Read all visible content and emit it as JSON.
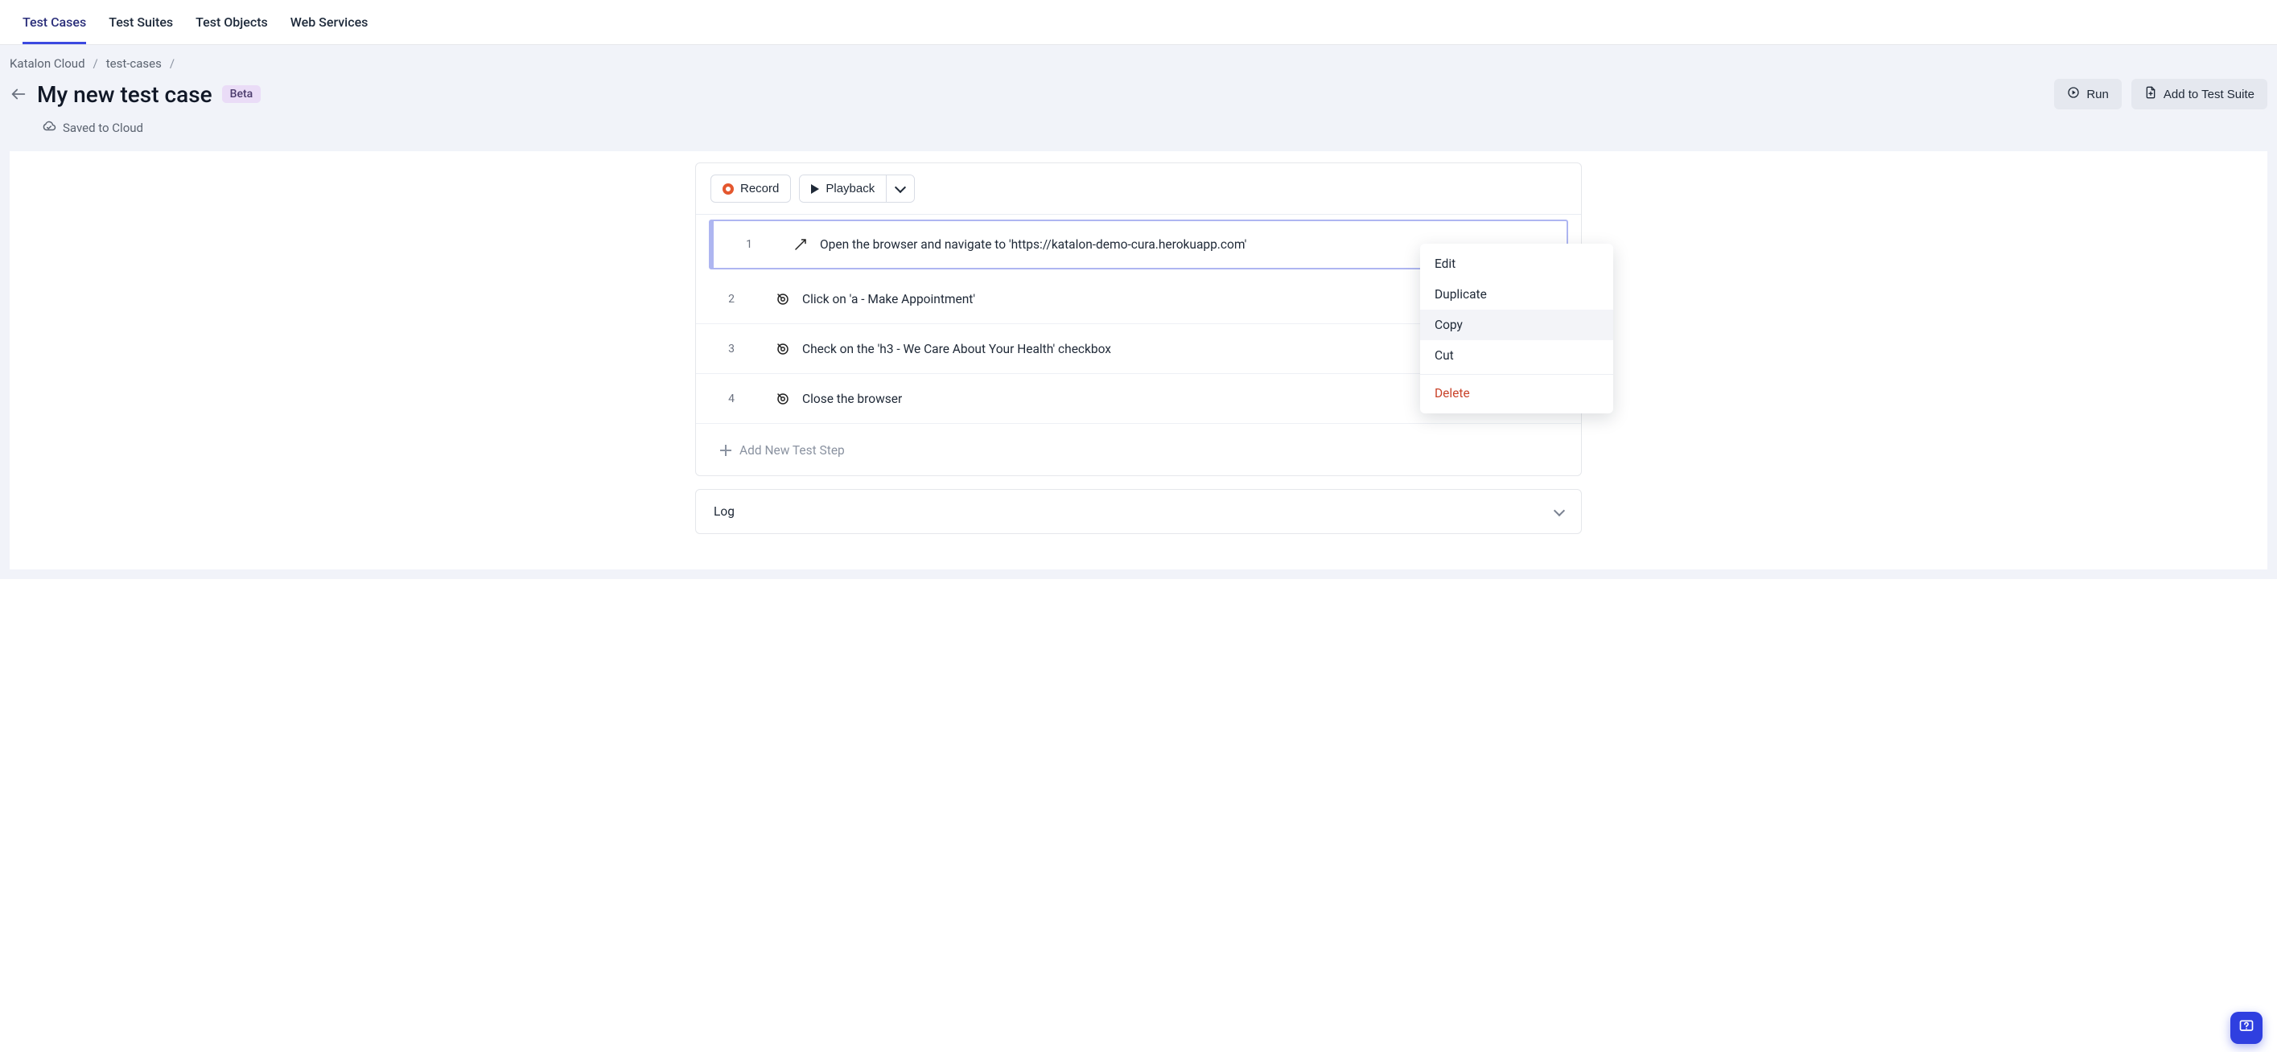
{
  "tabs": {
    "items": [
      {
        "label": "Test Cases",
        "active": true
      },
      {
        "label": "Test Suites",
        "active": false
      },
      {
        "label": "Test Objects",
        "active": false
      },
      {
        "label": "Web Services",
        "active": false
      }
    ]
  },
  "breadcrumbs": {
    "root": "Katalon Cloud",
    "second": "test-cases"
  },
  "header": {
    "title": "My new test case",
    "badge": "Beta",
    "saved_status": "Saved to Cloud",
    "run_label": "Run",
    "add_to_suite_label": "Add to Test Suite"
  },
  "toolbar": {
    "record_label": "Record",
    "playback_label": "Playback"
  },
  "steps": [
    {
      "num": "1",
      "icon": "navigate",
      "text": "Open the browser and navigate to 'https://katalon-demo-cura.herokuapp.com'",
      "selected": true
    },
    {
      "num": "2",
      "icon": "target",
      "text": "Click on 'a - Make Appointment'",
      "selected": false
    },
    {
      "num": "3",
      "icon": "target",
      "text": "Check on the 'h3 - We Care About Your Health' checkbox",
      "selected": false
    },
    {
      "num": "4",
      "icon": "target",
      "text": "Close the browser",
      "selected": false
    }
  ],
  "add_step_label": "Add New Test Step",
  "context_menu": {
    "edit": "Edit",
    "duplicate": "Duplicate",
    "copy": "Copy",
    "cut": "Cut",
    "delete": "Delete",
    "hovered": "copy"
  },
  "log": {
    "label": "Log"
  }
}
